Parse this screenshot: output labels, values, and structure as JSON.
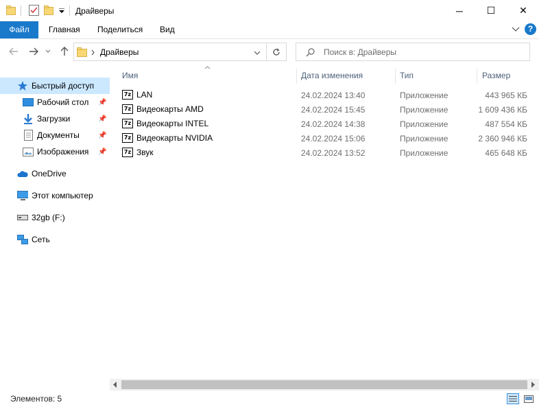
{
  "window": {
    "title": "Драйверы",
    "minimize": "─",
    "maximize": "☐",
    "close": "✕"
  },
  "ribbon": {
    "tabs": [
      "Файл",
      "Главная",
      "Поделиться",
      "Вид"
    ],
    "help": "?"
  },
  "address": {
    "path": "Драйверы",
    "search_placeholder": "Поиск в: Драйверы"
  },
  "nav": {
    "quick_access": "Быстрый доступ",
    "pinned": [
      "Рабочий стол",
      "Загрузки",
      "Документы",
      "Изображения"
    ],
    "onedrive": "OneDrive",
    "this_pc": "Этот компьютер",
    "drive": "32gb (F:)",
    "network": "Сеть"
  },
  "list": {
    "columns": [
      "Имя",
      "Дата изменения",
      "Тип",
      "Размер"
    ],
    "icon_label": "7z",
    "files": [
      {
        "name": "LAN",
        "date": "24.02.2024 13:40",
        "type": "Приложение",
        "size": "443 965 КБ"
      },
      {
        "name": "Видеокарты AMD",
        "date": "24.02.2024 15:45",
        "type": "Приложение",
        "size": "1 609 436 КБ"
      },
      {
        "name": "Видеокарты INTEL",
        "date": "24.02.2024 14:38",
        "type": "Приложение",
        "size": "487 554 КБ"
      },
      {
        "name": "Видеокарты NVIDIA",
        "date": "24.02.2024 15:06",
        "type": "Приложение",
        "size": "2 360 946 КБ"
      },
      {
        "name": "Звук",
        "date": "24.02.2024 13:52",
        "type": "Приложение",
        "size": "465 648 КБ"
      }
    ]
  },
  "status": {
    "items": "Элементов: 5"
  },
  "colors": {
    "accent": "#1979ca",
    "selection": "#cce8ff",
    "folder": "#f8d775"
  }
}
